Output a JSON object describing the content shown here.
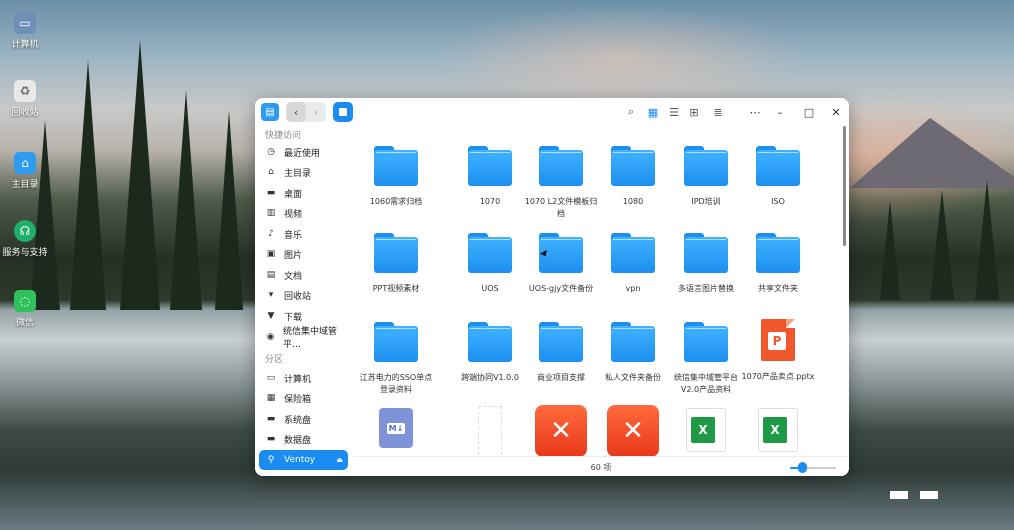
{
  "desktop": {
    "icons": [
      {
        "label": "计算机",
        "icon": "computer-icon"
      },
      {
        "label": "回收站",
        "icon": "trash-icon"
      },
      {
        "label": "主目录",
        "icon": "home-folder-icon"
      },
      {
        "label": "服务与支持",
        "icon": "support-icon"
      },
      {
        "label": "微信",
        "icon": "wechat-icon"
      }
    ]
  },
  "window": {
    "toolbar_icons": [
      "search-icon",
      "icon-view-icon",
      "list-view-icon",
      "tree-view-icon",
      "detail-panel-icon"
    ],
    "window_buttons": [
      "more-icon",
      "minimize-icon",
      "maximize-icon",
      "close-icon"
    ]
  },
  "sidebar": {
    "quick_access_heading": "快捷访问",
    "quick_access": [
      {
        "label": "最近使用",
        "icon": "clock-icon"
      },
      {
        "label": "主目录",
        "icon": "home-icon"
      },
      {
        "label": "桌面",
        "icon": "desktop-icon"
      },
      {
        "label": "视频",
        "icon": "video-icon"
      },
      {
        "label": "音乐",
        "icon": "music-icon"
      },
      {
        "label": "图片",
        "icon": "picture-icon"
      },
      {
        "label": "文档",
        "icon": "document-icon"
      },
      {
        "label": "回收站",
        "icon": "trash-icon"
      },
      {
        "label": "下载",
        "icon": "download-icon"
      },
      {
        "label": "统信集中域管平…",
        "icon": "domain-icon"
      }
    ],
    "partitions_heading": "分区",
    "partitions": [
      {
        "label": "计算机",
        "icon": "computer-icon"
      },
      {
        "label": "保险箱",
        "icon": "vault-icon"
      },
      {
        "label": "系统盘",
        "icon": "disk-icon"
      },
      {
        "label": "数据盘",
        "icon": "disk-icon"
      },
      {
        "label": "Ventoy",
        "icon": "usb-icon",
        "selected": true
      }
    ]
  },
  "files": [
    {
      "name": "1060需求归档",
      "type": "folder"
    },
    {
      "name": "1070",
      "type": "folder"
    },
    {
      "name": "1070 L2文件模板归档",
      "type": "folder"
    },
    {
      "name": "1080",
      "type": "folder"
    },
    {
      "name": "IPD培训",
      "type": "folder"
    },
    {
      "name": "ISO",
      "type": "folder"
    },
    {
      "name": "PPT视频素材",
      "type": "folder"
    },
    {
      "name": "UOS",
      "type": "folder"
    },
    {
      "name": "UOS-gjy文件备份",
      "type": "folder"
    },
    {
      "name": "vpn",
      "type": "folder"
    },
    {
      "name": "多语言图片替换",
      "type": "folder"
    },
    {
      "name": "共享文件夹",
      "type": "folder"
    },
    {
      "name": "江苏电力的SSO单点登录资料",
      "type": "folder"
    },
    {
      "name": "跨端协同V1.0.0",
      "type": "folder"
    },
    {
      "name": "商业项目支撑",
      "type": "folder"
    },
    {
      "name": "私人文件夹备份",
      "type": "folder"
    },
    {
      "name": "统信集中域管平台V2.0产品资料",
      "type": "folder"
    },
    {
      "name": "1070产品卖点.pptx",
      "type": "pptx"
    },
    {
      "name": "",
      "type": "markdown"
    },
    {
      "name": "",
      "type": "blank"
    },
    {
      "name": "",
      "type": "xmind"
    },
    {
      "name": "",
      "type": "xmind"
    },
    {
      "name": "",
      "type": "excel"
    },
    {
      "name": "",
      "type": "excel"
    }
  ],
  "status": {
    "item_count": "60 项",
    "zoom_level": 0.25
  },
  "colors": {
    "accent": "#1a8bf0",
    "folder": "#2d9cf0"
  }
}
